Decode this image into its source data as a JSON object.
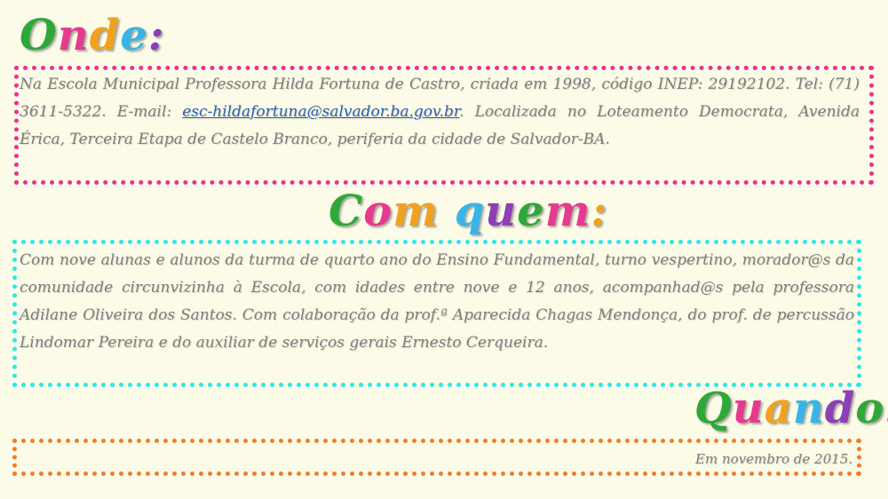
{
  "onde": {
    "title": "Onde:",
    "title_letter_colors": [
      "#2fa83a",
      "#e63a8f",
      "#f0a21e",
      "#37b5e8",
      "#8c3fb6"
    ],
    "text_before_email": "Na Escola Municipal Professora Hilda Fortuna de Castro, criada em 1998, código INEP: 29192102. Tel: (71) 3611-5322. E-mail: ",
    "email": "esc-hildafortuna@salvador.ba.gov.br",
    "text_after_email": ". Localizada no Loteamento Democrata, Avenida Érica, Terceira Etapa de Castelo Branco, periferia da cidade de Salvador-BA.",
    "border_color": "#ee2f93"
  },
  "com_quem": {
    "title": "Com quem:",
    "title_letter_colors": [
      "#2fa83a",
      "#e63a8f",
      "#f0a21e",
      "#37b5e8",
      "#8c3fb6",
      "#2fa83a",
      "#e63a8f",
      "#f0a21e",
      "#37b5e8"
    ],
    "text": "Com nove alunas e alunos da turma de quarto ano do Ensino Fundamental, turno vespertino, morador@s da comunidade circunvizinha à Escola, com idades entre nove e 12 anos, acompanhad@s pela professora Adilane Oliveira dos Santos. Com colaboração da prof.ª Aparecida Chagas Mendonça, do prof. de percussão Lindomar Pereira e do auxiliar de serviços gerais Ernesto Cerqueira.",
    "border_color": "#2ee6ea"
  },
  "quando": {
    "title": "Quando:",
    "title_letter_colors": [
      "#2fa83a",
      "#e63a8f",
      "#f0a21e",
      "#37b5e8",
      "#8c3fb6",
      "#2fa83a",
      "#e63a8f"
    ],
    "text": "Em novembro de 2015.",
    "border_color": "#f07d2a"
  }
}
